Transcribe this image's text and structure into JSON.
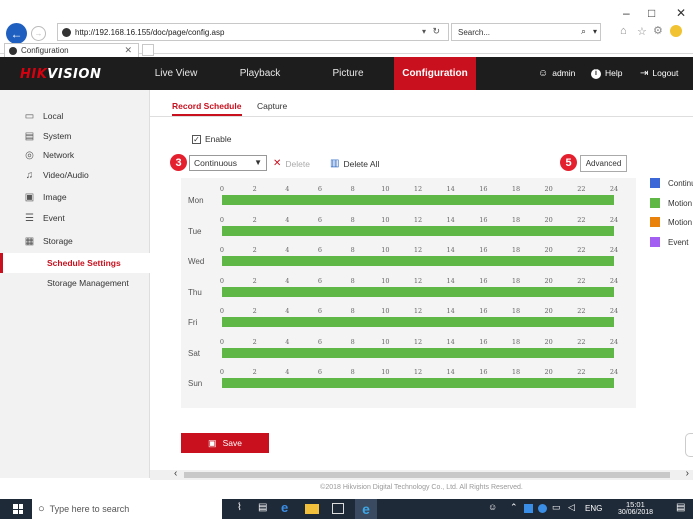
{
  "browser": {
    "url": "http://192.168.16.155/doc/page/config.asp",
    "search_placeholder": "Search...",
    "tab_title": "Configuration",
    "win_min": "–",
    "win_max": "□",
    "win_close": "✕"
  },
  "header": {
    "logo_hik": "HIK",
    "logo_vision": "VISION",
    "nav": [
      "Live View",
      "Playback",
      "Picture",
      "Configuration"
    ],
    "user": "admin",
    "help": "Help",
    "logout": "Logout"
  },
  "sidebar": {
    "items": [
      {
        "label": "Local",
        "icon": "monitor-icon"
      },
      {
        "label": "System",
        "icon": "system-icon"
      },
      {
        "label": "Network",
        "icon": "globe-icon"
      },
      {
        "label": "Video/Audio",
        "icon": "audio-icon"
      },
      {
        "label": "Image",
        "icon": "image-icon"
      },
      {
        "label": "Event",
        "icon": "event-icon"
      },
      {
        "label": "Storage",
        "icon": "storage-icon"
      }
    ],
    "sub_items": [
      "Schedule Settings",
      "Storage Management"
    ],
    "active_sub": "Schedule Settings"
  },
  "tabs": [
    "Record Schedule",
    "Capture"
  ],
  "schedule": {
    "enable_label": "Enable",
    "enable_checked": true,
    "mode_value": "Continuous",
    "delete_label": "Delete",
    "delete_all_label": "Delete All",
    "advanced_label": "Advanced",
    "days": [
      "Mon",
      "Tue",
      "Wed",
      "Thu",
      "Fri",
      "Sat",
      "Sun"
    ],
    "hours": [
      "0",
      "2",
      "4",
      "6",
      "8",
      "10",
      "12",
      "14",
      "16",
      "18",
      "20",
      "22",
      "24"
    ],
    "coverage_start_hour": 0,
    "coverage_end_hour": 24,
    "bar_color": "#5fb845"
  },
  "legend": [
    {
      "label": "Continu",
      "color": "#3c67d6"
    },
    {
      "label": "Motion",
      "color": "#5fb845"
    },
    {
      "label": "Motion",
      "color": "#e8820c"
    },
    {
      "label": "Event",
      "color": "#a35ff2"
    }
  ],
  "badges": {
    "first": "3",
    "second": "5"
  },
  "save_label": "Save",
  "footer": "©2018 Hikvision Digital Technology Co., Ltd. All Rights Reserved.",
  "taskbar": {
    "search_placeholder": "Type here to search",
    "lang": "ENG",
    "time": "15:01",
    "date": "30/06/2018"
  },
  "colors": {
    "accent": "#c8101e",
    "header_bg": "#1d1d1d"
  }
}
